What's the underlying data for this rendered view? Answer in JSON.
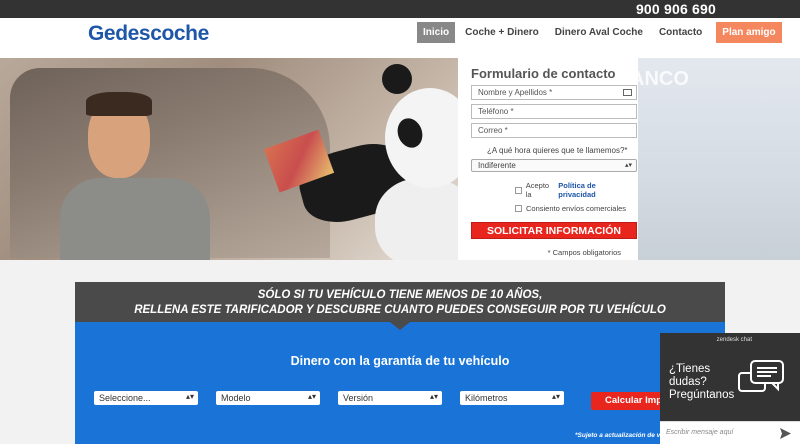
{
  "topbar": {
    "phone": "900 906 690"
  },
  "header": {
    "logo": "Gedescoche",
    "nav": [
      "Inicio",
      "Coche + Dinero",
      "Dinero Aval Coche",
      "Contacto",
      "Plan amigo"
    ]
  },
  "hero": {
    "background_sign": "ANCO"
  },
  "form": {
    "title": "Formulario de contacto",
    "name_placeholder": "Nombre y Apellidos *",
    "phone_placeholder": "Teléfono *",
    "email_placeholder": "Correo *",
    "question": "¿A qué hora quieres que te llamemos?*",
    "time_selected": "Indiferente",
    "privacy_prefix": "Acepto la",
    "privacy_link": "Política de privacidad",
    "commercial": "Consiento envíos comerciales",
    "submit": "SOLICITAR INFORMACIÓN",
    "required_note": "* Campos obligatorios"
  },
  "tarificador": {
    "heading_line1": "SÓLO SI TU VEHÍCULO TIENE MENOS DE 10 AÑOS,",
    "heading_line2": "RELLENA ESTE TARIFICADOR Y DESCUBRE CUANTO PUEDES CONSEGUIR POR TU VEHÍCULO",
    "title": "Dinero con la garantía de tu vehículo",
    "selects": [
      "Seleccione...",
      "Modelo",
      "Versión",
      "Kilómetros"
    ],
    "calc_button": "Calcular Impo",
    "note": "*Sujeto a actualización de va"
  },
  "chat": {
    "brand": "zendesk chat",
    "message_line1": "¿Tienes",
    "message_line2": "dudas?",
    "message_line3": "Pregúntanos",
    "input_placeholder": "Escribir mensaje aquí"
  },
  "colors": {
    "brand_blue": "#1e56a8",
    "accent_red": "#e8261e",
    "plan_orange": "#f5875f",
    "tar_blue": "#1a74d8"
  }
}
